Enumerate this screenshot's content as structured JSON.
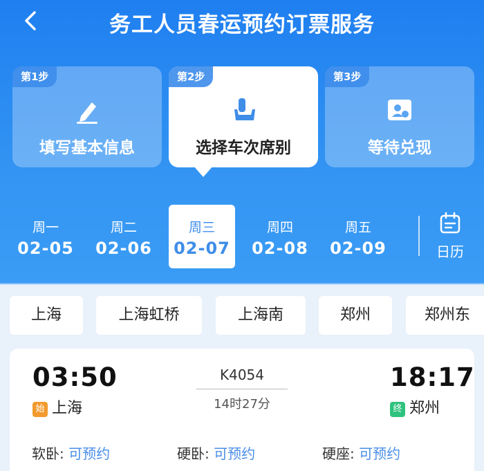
{
  "header": {
    "title": "务工人员春运预约订票服务"
  },
  "steps": [
    {
      "tag": "第1步",
      "label": "填写基本信息",
      "icon": "edit-icon"
    },
    {
      "tag": "第2步",
      "label": "选择车次席别",
      "icon": "seat-icon"
    },
    {
      "tag": "第3步",
      "label": "等待兑现",
      "icon": "ticket-icon"
    }
  ],
  "days": [
    {
      "weekday": "周一",
      "date": "02-05"
    },
    {
      "weekday": "周二",
      "date": "02-06"
    },
    {
      "weekday": "周三",
      "date": "02-07"
    },
    {
      "weekday": "周四",
      "date": "02-08"
    },
    {
      "weekday": "周五",
      "date": "02-09"
    }
  ],
  "calendar": {
    "label": "日历"
  },
  "stations": [
    "上海",
    "上海虹桥",
    "上海南",
    "郑州",
    "郑州东"
  ],
  "train": {
    "depart_time": "03:50",
    "depart_badge": "始",
    "depart_station": "上海",
    "number": "K4054",
    "duration": "14时27分",
    "arrive_time": "18:17",
    "arrive_badge": "终",
    "arrive_station": "郑州",
    "seats": [
      {
        "type": "软卧:",
        "status": "可预约"
      },
      {
        "type": "硬卧:",
        "status": "可预约"
      },
      {
        "type": "硬座:",
        "status": "可预约"
      }
    ]
  },
  "colors": {
    "accent": "#3f8de8",
    "depart_badge": "#f29a2e",
    "arrive_badge": "#2ec27e"
  }
}
